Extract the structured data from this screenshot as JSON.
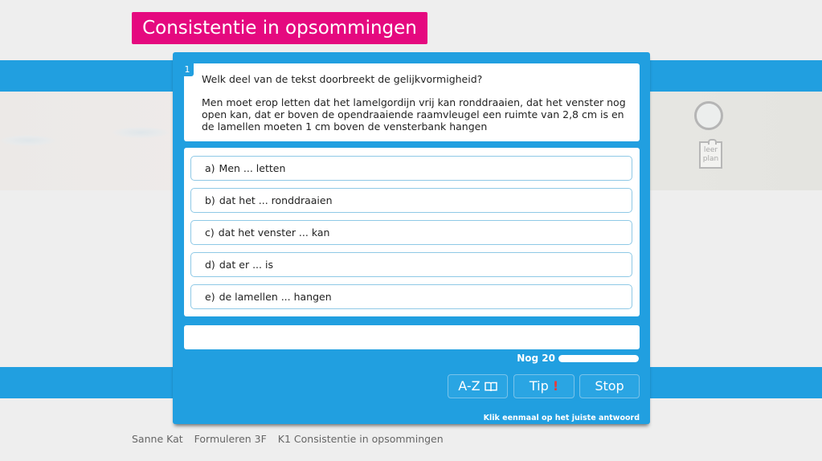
{
  "header": {
    "title": "Consistentie in opsommingen",
    "title_color": "#e5097f"
  },
  "colors": {
    "accent": "#219fe0",
    "tip_mark": "#e63c3c"
  },
  "side": {
    "circle_icon": "status-circle-icon",
    "plan_icon": "clipboard-icon",
    "plan_label_line1": "leer",
    "plan_label_line2": "plan"
  },
  "question": {
    "number": "1",
    "prompt": "Welk deel van de tekst doorbreekt de gelijkvormigheid?",
    "text": "Men moet erop letten dat het lamelgordijn vrij kan ronddraaien, dat het venster nog open kan, dat er boven de opendraaiende raamvleugel een ruimte van 2,8 cm is en de lamellen moeten 1 cm boven de vensterbank hangen"
  },
  "answers": [
    {
      "letter": "a)",
      "text": "Men ... letten"
    },
    {
      "letter": "b)",
      "text": "dat het ... ronddraaien"
    },
    {
      "letter": "c)",
      "text": "dat het venster ... kan"
    },
    {
      "letter": "d)",
      "text": "dat er ... is"
    },
    {
      "letter": "e)",
      "text": "de lamellen ... hangen"
    }
  ],
  "feedback": {
    "text": ""
  },
  "progress": {
    "label": "Nog 20",
    "remaining": 20,
    "fraction_remaining": 1.0
  },
  "buttons": {
    "az_label": "A-Z",
    "az_icon": "book-icon",
    "tip_label": "Tip",
    "tip_mark": "!",
    "stop_label": "Stop"
  },
  "instruction": "Klik eenmaal op het juiste antwoord",
  "footer": {
    "student": "Sanne Kat",
    "course": "Formuleren 3F",
    "lesson": "K1 Consistentie in opsommingen"
  }
}
